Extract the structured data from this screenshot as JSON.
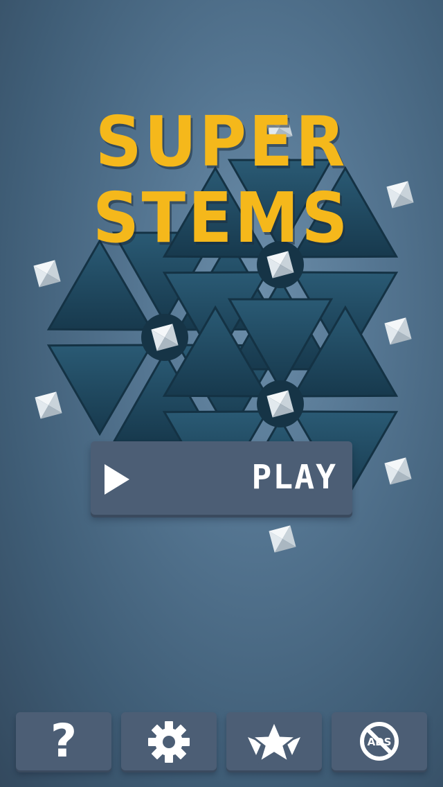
{
  "title": {
    "line1": "SUPER",
    "line2": "STEMS"
  },
  "play_button": {
    "label": "PLAY",
    "icon": "play-icon"
  },
  "bottom_bar": {
    "buttons": [
      {
        "name": "help",
        "glyph": "?",
        "icon": "question-mark-icon"
      },
      {
        "name": "settings",
        "icon": "gear-icon"
      },
      {
        "name": "rate",
        "icon": "star-icon"
      },
      {
        "name": "remove-ads",
        "icon": "no-ads-icon",
        "badge_text": "ADS"
      }
    ]
  },
  "colors": {
    "title": "#f5b81b",
    "button_bg": "#4c5e75",
    "board_tile": "#1f4a62",
    "gem": "#e8eef2"
  }
}
